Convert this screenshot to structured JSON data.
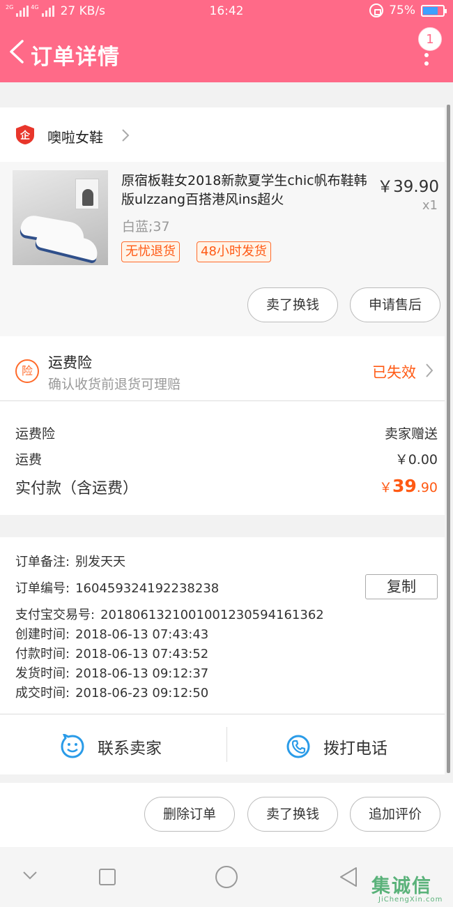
{
  "status_bar": {
    "net1": "2G",
    "net2": "4G",
    "speed": "27 KB/s",
    "time": "16:42",
    "battery": "75%",
    "battery_level": 0.75
  },
  "header": {
    "title": "订单详情",
    "notification_count": "1",
    "background_color": "#ff6a88"
  },
  "shop": {
    "name": "噢啦女鞋"
  },
  "product": {
    "title": "原宿板鞋女2018新款夏学生chic帆布鞋韩版ulzzang百搭港风ins超火",
    "price": "￥39.90",
    "quantity": "x1",
    "sku": "白蓝;37",
    "tags": [
      "无忧退货",
      "48小时发货"
    ],
    "actions": [
      "卖了换钱",
      "申请售后"
    ]
  },
  "insurance": {
    "icon_char": "险",
    "title": "运费险",
    "subtitle": "确认收货前退货可理赔",
    "status": "已失效"
  },
  "fees": {
    "rows": [
      {
        "label": "运费险",
        "value": "卖家赠送"
      },
      {
        "label": "运费",
        "value": "￥0.00"
      }
    ],
    "total_label": "实付款（含运费）",
    "total_symbol": "￥",
    "total_int": "39",
    "total_dec": ".90"
  },
  "order_info": {
    "copy_label": "复制",
    "rows": [
      {
        "label": "订单备注:",
        "value": "别发天天"
      },
      {
        "label": "订单编号:",
        "value": "160459324192238238"
      },
      {
        "label": "支付宝交易号:",
        "value": "2018061321001001230594161362"
      },
      {
        "label": "创建时间:",
        "value": "2018-06-13 07:43:43"
      },
      {
        "label": "付款时间:",
        "value": "2018-06-13 07:43:52"
      },
      {
        "label": "发货时间:",
        "value": "2018-06-13 09:12:37"
      },
      {
        "label": "成交时间:",
        "value": "2018-06-23 09:12:50"
      }
    ]
  },
  "contact": {
    "seller_label": "联系卖家",
    "phone_label": "拨打电话",
    "icon_color": "#2a9be8"
  },
  "bottom_actions": [
    "删除订单",
    "卖了换钱",
    "追加评价"
  ],
  "watermark": {
    "cn": "集诚信",
    "en": "JiChengXin.com"
  }
}
